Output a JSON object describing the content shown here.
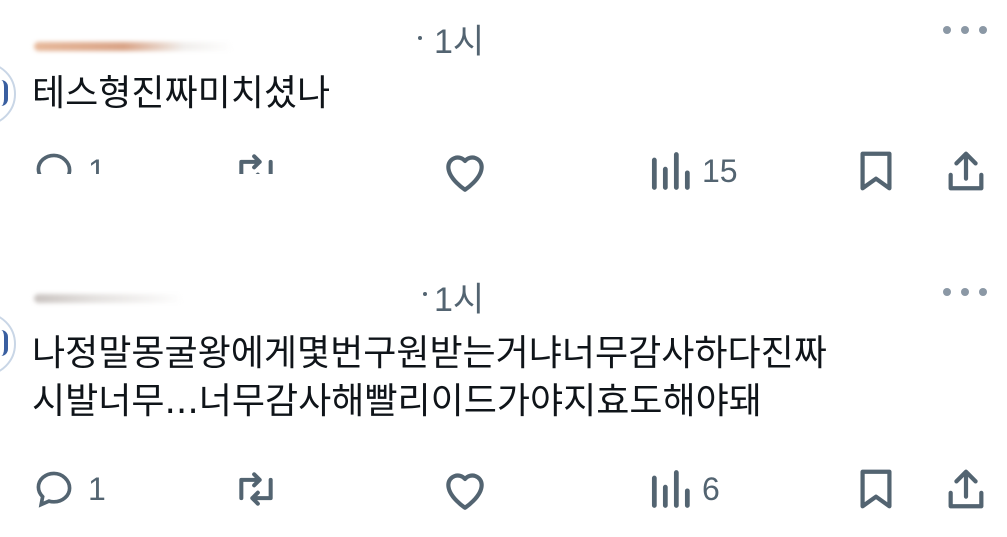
{
  "posts": [
    {
      "name_fragment": "",
      "time": "1시",
      "text": "테스형진짜미치셨나",
      "reply_count": "1",
      "views_count": "15"
    },
    {
      "name_fragment": "",
      "time": "1시",
      "text": "나정말몽굴왕에게몇번구원받는거냐너무감사하다진짜\n시발너무...너무감사해빨리이드가야지효도해야돼",
      "reply_count": "1",
      "views_count": "6"
    }
  ],
  "icons": {
    "reply": "reply-bubble-icon",
    "repost": "repost-arrows-icon",
    "like": "heart-icon",
    "views": "views-bars-icon",
    "bookmark": "bookmark-icon",
    "share": "share-upload-icon",
    "more": "more-dots-icon"
  },
  "colors": {
    "icon": "#536471",
    "text": "#0f1419"
  }
}
